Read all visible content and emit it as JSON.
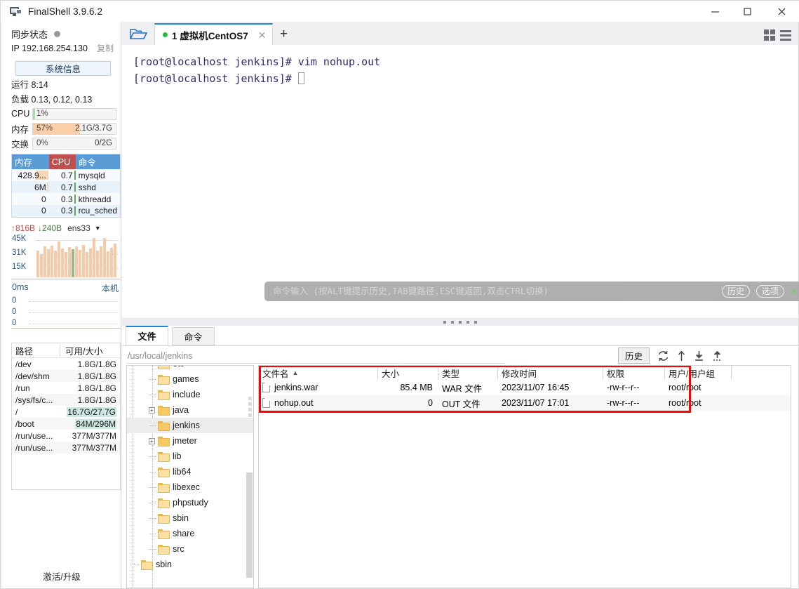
{
  "window": {
    "title": "FinalShell 3.9.6.2",
    "icon": "monitor-icon",
    "minimize": "—",
    "maximize": "□",
    "close": "✕"
  },
  "sidebar": {
    "sync_label": "同步状态",
    "ip_label": "IP 192.168.254.130",
    "copy_label": "复制",
    "sysinfo_button": "系统信息",
    "uptime": "运行 8:14",
    "load": "负载 0.13, 0.12, 0.13",
    "meters": [
      {
        "label": "CPU",
        "percent": "1%",
        "value": "",
        "fill": 1,
        "color": "#a8dca8"
      },
      {
        "label": "内存",
        "percent": "57%",
        "value": "2.1G/3.7G",
        "fill": 57,
        "color": "#fbd0a8"
      },
      {
        "label": "交换",
        "percent": "0%",
        "value": "0/2G",
        "fill": 0,
        "color": "#cde3f6"
      }
    ],
    "proc_headers": [
      "内存",
      "CPU",
      "命令"
    ],
    "proc_rows": [
      {
        "mem": "428.9...",
        "cpu": "0.7",
        "cmd": "mysqld",
        "mem_bar": 18
      },
      {
        "mem": "6M",
        "cpu": "0.7",
        "cmd": "sshd",
        "mem_bar": 2
      },
      {
        "mem": "0",
        "cpu": "0.3",
        "cmd": "kthreadd",
        "mem_bar": 0
      },
      {
        "mem": "0",
        "cpu": "0.3",
        "cmd": "rcu_sched",
        "mem_bar": 0
      }
    ],
    "net": {
      "up": "↑816B",
      "down": "↓240B",
      "interface": "ens33",
      "caret": "▼",
      "y_labels": [
        "45K",
        "31K",
        "15K"
      ]
    },
    "latency": {
      "label": "0ms",
      "host": "本机",
      "y_labels": [
        "0",
        "0",
        "0"
      ]
    },
    "disk_headers": [
      "路径",
      "可用/大小"
    ],
    "disk_rows": [
      {
        "path": "/dev",
        "size": "1.8G/1.8G",
        "hl": false
      },
      {
        "path": "/dev/shm",
        "size": "1.8G/1.8G",
        "hl": false
      },
      {
        "path": "/run",
        "size": "1.8G/1.8G",
        "hl": false
      },
      {
        "path": "/sys/fs/c...",
        "size": "1.8G/1.8G",
        "hl": false
      },
      {
        "path": "/",
        "size": "16.7G/27.7G",
        "hl": true
      },
      {
        "path": "/boot",
        "size": "84M/296M",
        "hl": true
      },
      {
        "path": "/run/use...",
        "size": "377M/377M",
        "hl": false
      },
      {
        "path": "/run/use...",
        "size": "377M/377M",
        "hl": false
      }
    ],
    "activate": "激活/升级"
  },
  "tabbar": {
    "folder_icon": "open-folder-icon",
    "tab_label": "1 虚拟机CentOS7",
    "tab_close": "✕",
    "add_tab": "+",
    "grid_icon": "grid-view-icon",
    "menu_icon": "hamburger-menu-icon"
  },
  "terminal": {
    "lines": [
      "[root@localhost jenkins]# vim nohup.out",
      "[root@localhost jenkins]# "
    ]
  },
  "command_bar": {
    "placeholder": "命令输入 (按ALT键提示历史,TAB键路径,ESC键返回,双击CTRL切换)",
    "history_button": "历史",
    "options_button": "选项",
    "icons": [
      "bolt-icon",
      "copy-icon",
      "paste-icon",
      "search-icon",
      "gear-icon",
      "download-icon",
      "window-icon"
    ]
  },
  "file_panel": {
    "tabs": [
      {
        "label": "文件",
        "active": true
      },
      {
        "label": "命令",
        "active": false
      }
    ],
    "path": "/usr/local/jenkins",
    "history_button": "历史",
    "toolbar_icons": [
      "refresh-icon",
      "up-arrow-icon",
      "download-icon",
      "upload-icon"
    ],
    "tree": [
      {
        "label": "etc",
        "expandable": false,
        "selected": false,
        "level": 1
      },
      {
        "label": "games",
        "expandable": false,
        "selected": false,
        "level": 1
      },
      {
        "label": "include",
        "expandable": false,
        "selected": false,
        "level": 1
      },
      {
        "label": "java",
        "expandable": true,
        "selected": false,
        "level": 1
      },
      {
        "label": "jenkins",
        "expandable": false,
        "selected": true,
        "level": 1
      },
      {
        "label": "jmeter",
        "expandable": true,
        "selected": false,
        "level": 1
      },
      {
        "label": "lib",
        "expandable": false,
        "selected": false,
        "level": 1
      },
      {
        "label": "lib64",
        "expandable": false,
        "selected": false,
        "level": 1
      },
      {
        "label": "libexec",
        "expandable": false,
        "selected": false,
        "level": 1
      },
      {
        "label": "phpstudy",
        "expandable": false,
        "selected": false,
        "level": 1
      },
      {
        "label": "sbin",
        "expandable": false,
        "selected": false,
        "level": 1
      },
      {
        "label": "share",
        "expandable": false,
        "selected": false,
        "level": 1
      },
      {
        "label": "src",
        "expandable": false,
        "selected": false,
        "level": 1
      },
      {
        "label": "sbin",
        "expandable": false,
        "selected": false,
        "level": 0
      }
    ],
    "columns": [
      "文件名",
      "大小",
      "类型",
      "修改时间",
      "权限",
      "用户/用户组"
    ],
    "sort_arrow": "▲",
    "rows": [
      {
        "name": "jenkins.war",
        "size": "85.4 MB",
        "type": "WAR 文件",
        "time": "2023/11/07 16:45",
        "perm": "-rw-r--r--",
        "owner": "root/root"
      },
      {
        "name": "nohup.out",
        "size": "0",
        "type": "OUT 文件",
        "time": "2023/11/07 17:01",
        "perm": "-rw-r--r--",
        "owner": "root/root"
      }
    ]
  },
  "colors": {
    "accent": "#1e86d8",
    "highlight_box": "#fb0202",
    "status_dot": "#27c040",
    "header_blue": "#5b9bd5",
    "header_red": "#c0504d"
  }
}
